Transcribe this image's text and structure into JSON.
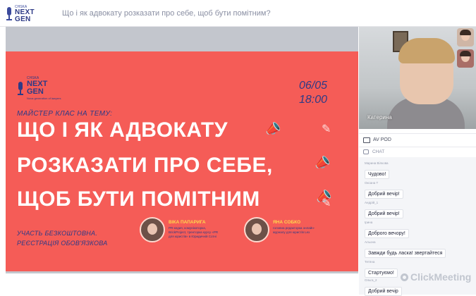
{
  "app": {
    "logo_small": "CHSKA",
    "logo_big_1": "NEXT",
    "logo_big_2": "GEN",
    "meeting_title": "Що і як адвокату розказати про себе, щоб бути помітним?"
  },
  "slide": {
    "logo_small": "CHSKA",
    "logo_big_1": "NEXT",
    "logo_big_2": "GEN",
    "logo_sub": "Nova generation of lawyers",
    "date": "06/05",
    "time": "18:00",
    "subtitle": "МАЙСТЕР КЛАС НА ТЕМУ:",
    "headline_1": "ЩО І ЯК АДВОКАТУ",
    "headline_2": "РОЗКАЗАТИ ПРО СЕБЕ,",
    "headline_3": "ЩОБ БУТИ ПОМІТНИМ",
    "free": "УЧАСТЬ БЕЗКОШТОВНА.",
    "registration": "РЕЄСТРАЦІЯ ОБОВ'ЯЗКОВА",
    "speakers": [
      {
        "name": "ВІКА ПАПАРИГА",
        "desc": "PR-кедия, комунікаторка, BrickProject, тренторка курсу «PR для юристів» в Юридичній Сотні"
      },
      {
        "name": "ЯНА СОБКО",
        "desc": "головна редакторка онлайн-журналу для юристів Lex"
      }
    ]
  },
  "video": {
    "main_name": "Катерина",
    "av_label": "AV POD"
  },
  "chat": {
    "title": "CHAT",
    "messages": [
      {
        "author": "Марина Вілкова",
        "text": "Чудово!"
      },
      {
        "author": "Оксана Т",
        "text": "Добрий вечір!"
      },
      {
        "author": "Андрій_1",
        "text": "Добрий вечір!"
      },
      {
        "author": "Ірина",
        "text": "Доброго вечору!"
      },
      {
        "author": "Альона",
        "text": "Завжди будь ласка! звертайтеся"
      },
      {
        "author": "Тетяна",
        "text": "Стартуємо!"
      },
      {
        "author": "Ольга_2",
        "text": "Добрий вечір"
      }
    ]
  },
  "watermark": "ClickMeeting",
  "colors": {
    "slide_bg": "#f55c57",
    "brand_blue": "#2d3a86",
    "accent_yellow": "#f7c543"
  }
}
